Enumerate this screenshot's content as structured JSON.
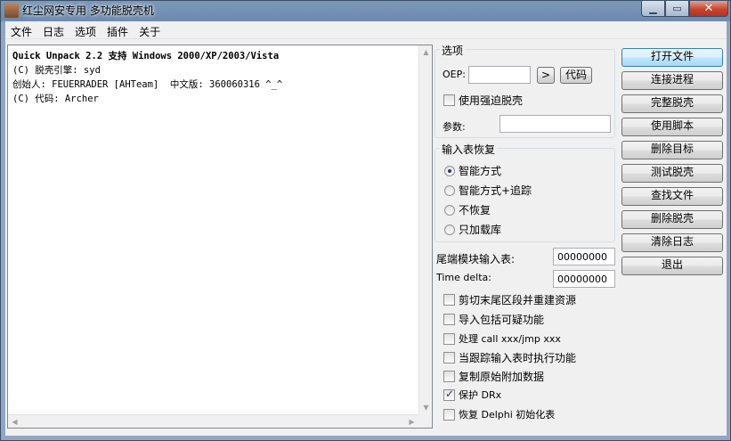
{
  "window": {
    "title": "红尘网安专用 多功能脱壳机",
    "controls": [
      "minimize-icon",
      "maximize-icon",
      "close-icon"
    ]
  },
  "menu": [
    "文件",
    "日志",
    "选项",
    "插件",
    "关于"
  ],
  "log": {
    "lines": [
      "Quick Unpack 2.2 支持 Windows 2000/XP/2003/Vista",
      "(C) 脱壳引擎: syd",
      "创始人: FEUERRADER [AHTeam]  中文版: 360060316 ^_^",
      "(C) 代码: Archer"
    ]
  },
  "options": {
    "title": "选项",
    "oep_label": "OEP:",
    "oep_value": "",
    "go_button": ">",
    "code_button": "代码",
    "force_unpack": "使用强迫脱壳",
    "force_unpack_checked": false,
    "params_label": "参数:",
    "params_value": ""
  },
  "import_recovery": {
    "title": "输入表恢复",
    "options": [
      "智能方式",
      "智能方式+追踪",
      "不恢复",
      "只加载库"
    ],
    "selected": 0
  },
  "fields": {
    "tail_import_label": "尾端模块输入表:",
    "tail_import_value": "00000000",
    "time_delta_label": "Time delta:",
    "time_delta_value": "00000000"
  },
  "checkboxes": [
    {
      "label": "剪切末尾区段并重建资源",
      "checked": false
    },
    {
      "label": "导入包括可疑功能",
      "checked": false
    },
    {
      "label": "处理 call xxx/jmp xxx",
      "checked": false
    },
    {
      "label": "当跟踪输入表时执行功能",
      "checked": false
    },
    {
      "label": "复制原始附加数据",
      "checked": false
    },
    {
      "label": "保护 DRx",
      "checked": true
    },
    {
      "label": "恢复 Delphi 初始化表",
      "checked": false
    }
  ],
  "actions": [
    "打开文件",
    "连接进程",
    "完整脱壳",
    "使用脚本",
    "删除目标",
    "测试脱壳",
    "查找文件",
    "删除脱壳",
    "清除日志",
    "退出"
  ],
  "colors": {
    "titlebar": "#6d8bae",
    "client": "#f0f0f0",
    "close_button": "#c7452f"
  }
}
